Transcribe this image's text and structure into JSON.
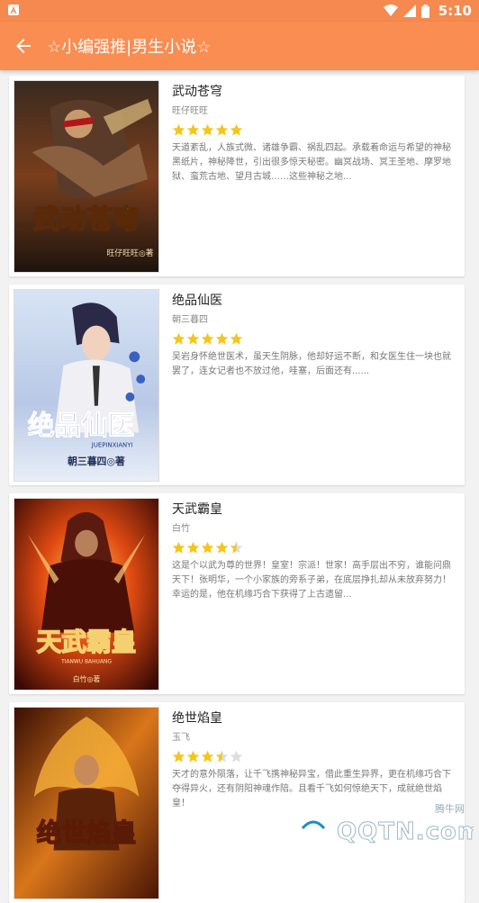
{
  "status_bar": {
    "time": "5:10"
  },
  "app_bar": {
    "title": "☆小编强推|男生小说☆"
  },
  "books": [
    {
      "title": "武动苍穹",
      "author": "旺仔旺旺",
      "rating": 5,
      "desc": "天道紊乱，人族式微、诸雄争霸、祸乱四起。承载着命运与希望的神秘黑纸片，神秘降世，引出很多惊天秘密。幽冥战场、冥王圣地、摩罗地狱、蛮荒古地、望月古城……这些神秘之地...",
      "cover_text": "武动苍穹",
      "cover_sub": "旺仔旺旺◎著"
    },
    {
      "title": "绝品仙医",
      "author": "朝三暮四",
      "rating": 5,
      "desc": "吴岩身怀绝世医术，虽天生阴脉，他却好运不断，和女医生住一块也就罢了，连女记者也不放过他，哇塞，后面还有......",
      "cover_text": "绝品仙医",
      "cover_pinyin": "JUEPINXIANYI",
      "cover_sub": "朝三暮四◎著"
    },
    {
      "title": "天武霸皇",
      "author": "白竹",
      "rating": 4.5,
      "desc": "这是个以武为尊的世界！皇室！宗派！世家！高手层出不穷，谁能问鼎天下！张明华，一个小家族的旁系子弟，在底层挣扎却从未放弃努力！幸运的是，他在机缘巧合下获得了上古遗留...",
      "cover_text": "天武霸皇",
      "cover_pinyin": "TIANWU BAHUANG",
      "cover_sub": "白竹◎著"
    },
    {
      "title": "绝世焰皇",
      "author": "玉飞",
      "rating": 3.5,
      "desc": "天才的意外陨落，让千飞携神秘异宝，借此重生异界，更在机缘巧合下夺得异火，还有阴阳神魂作陪。且看千飞如何惊绝天下，成就绝世焰皇！",
      "cover_text": "绝世焰皇"
    }
  ],
  "watermark": {
    "text": "QQTN.com",
    "small": "腾牛网"
  },
  "colors": {
    "accent": "#f98d52",
    "star": "#f5c518",
    "star_empty": "#dddddd"
  }
}
